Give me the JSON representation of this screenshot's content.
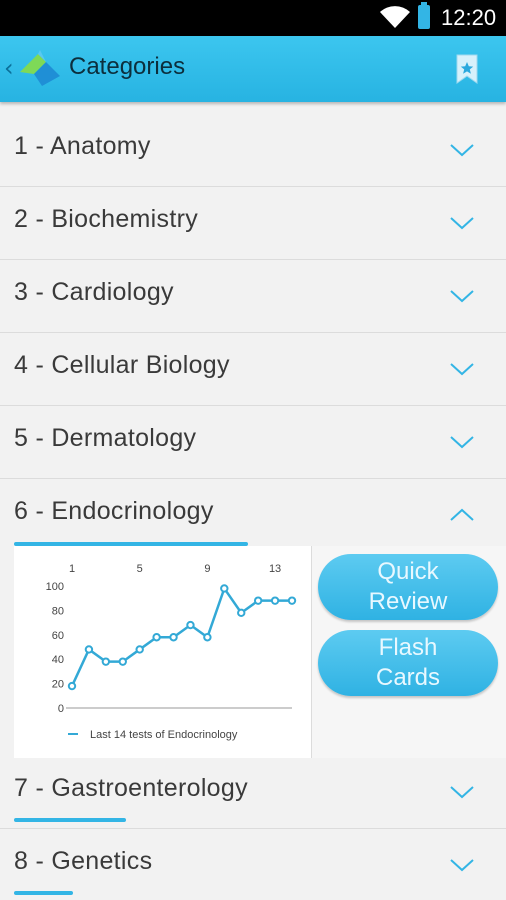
{
  "status_bar": {
    "time": "12:20",
    "icons": [
      "wifi-icon",
      "battery-icon"
    ]
  },
  "action_bar": {
    "title": "Categories",
    "back_icon": "chevron-left-icon",
    "logo_icon": "app-logo-icon",
    "action_icon": "bookmark-star-icon"
  },
  "colors": {
    "accent": "#33b5e5",
    "header": "#2fbbe8",
    "text": "#3a3a3a"
  },
  "categories": [
    {
      "label": "1 - Anatomy",
      "expanded": false,
      "progress": 0
    },
    {
      "label": "2 - Biochemistry",
      "expanded": false,
      "progress": 0
    },
    {
      "label": "3 - Cardiology",
      "expanded": false,
      "progress": 0
    },
    {
      "label": "4 - Cellular Biology",
      "expanded": false,
      "progress": 0
    },
    {
      "label": "5 - Dermatology",
      "expanded": false,
      "progress": 0
    },
    {
      "label": "6 - Endocrinology",
      "expanded": true,
      "progress": 1.0
    },
    {
      "label": "7 - Gastroenterology",
      "expanded": false,
      "progress": 0.48
    },
    {
      "label": "8 - Genetics",
      "expanded": false,
      "progress": 0.25
    }
  ],
  "expanded_panel": {
    "quick_review_label": "Quick Review",
    "flash_cards_label": "Flash Cards"
  },
  "chart_data": {
    "type": "line",
    "x": [
      1,
      2,
      3,
      4,
      5,
      6,
      7,
      8,
      9,
      10,
      11,
      12,
      13,
      14
    ],
    "series": [
      {
        "name": "Last 14 tests of Endocrinology",
        "values": [
          18,
          48,
          38,
          38,
          48,
          58,
          58,
          68,
          58,
          98,
          78,
          88,
          88,
          88
        ]
      }
    ],
    "x_ticks": [
      "1",
      "5",
      "9",
      "13"
    ],
    "y_ticks": [
      "0",
      "20",
      "40",
      "60",
      "80",
      "100"
    ],
    "ylim": [
      0,
      100
    ],
    "legend_position": "bottom",
    "color": "#33a9d6"
  }
}
